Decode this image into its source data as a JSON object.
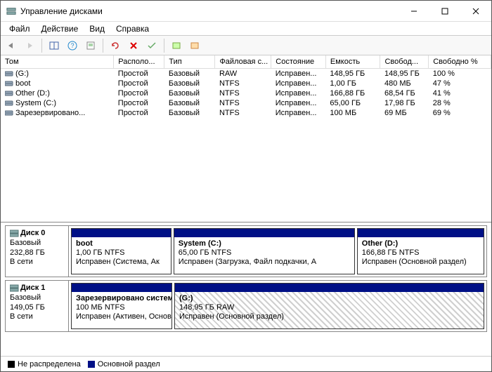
{
  "window": {
    "title": "Управление дисками"
  },
  "menu": {
    "file": "Файл",
    "action": "Действие",
    "view": "Вид",
    "help": "Справка"
  },
  "columns": {
    "volume": "Том",
    "layout": "Располо...",
    "type": "Тип",
    "fs": "Файловая с...",
    "status": "Состояние",
    "capacity": "Емкость",
    "free": "Свобод...",
    "free_pct": "Свободно %"
  },
  "col_widths": {
    "volume": 145,
    "layout": 65,
    "type": 65,
    "fs": 72,
    "status": 70,
    "capacity": 70,
    "free": 62,
    "free_pct": 80
  },
  "volumes": [
    {
      "name": "(G:)",
      "layout": "Простой",
      "type": "Базовый",
      "fs": "RAW",
      "status": "Исправен...",
      "capacity": "148,95 ГБ",
      "free": "148,95 ГБ",
      "free_pct": "100 %"
    },
    {
      "name": "boot",
      "layout": "Простой",
      "type": "Базовый",
      "fs": "NTFS",
      "status": "Исправен...",
      "capacity": "1,00 ГБ",
      "free": "480 МБ",
      "free_pct": "47 %"
    },
    {
      "name": "Other (D:)",
      "layout": "Простой",
      "type": "Базовый",
      "fs": "NTFS",
      "status": "Исправен...",
      "capacity": "166,88 ГБ",
      "free": "68,54 ГБ",
      "free_pct": "41 %"
    },
    {
      "name": "System (C:)",
      "layout": "Простой",
      "type": "Базовый",
      "fs": "NTFS",
      "status": "Исправен...",
      "capacity": "65,00 ГБ",
      "free": "17,98 ГБ",
      "free_pct": "28 %"
    },
    {
      "name": "Зарезервировано...",
      "layout": "Простой",
      "type": "Базовый",
      "fs": "NTFS",
      "status": "Исправен...",
      "capacity": "100 МБ",
      "free": "69 МБ",
      "free_pct": "69 %"
    }
  ],
  "disks": [
    {
      "title": "Диск 0",
      "type": "Базовый",
      "size": "232,88 ГБ",
      "state": "В сети",
      "partitions": [
        {
          "name": "boot",
          "sub": "1,00 ГБ NTFS",
          "status": "Исправен (Система, Ак",
          "flex": 1.1,
          "hatched": false
        },
        {
          "name": "System  (C:)",
          "sub": "65,00 ГБ NTFS",
          "status": "Исправен (Загрузка, Файл подкачки, А",
          "flex": 2.0,
          "hatched": false
        },
        {
          "name": "Other  (D:)",
          "sub": "166,88 ГБ NTFS",
          "status": "Исправен (Основной раздел)",
          "flex": 1.4,
          "hatched": false
        }
      ]
    },
    {
      "title": "Диск 1",
      "type": "Базовый",
      "size": "149,05 ГБ",
      "state": "В сети",
      "partitions": [
        {
          "name": "Зарезервировано системс",
          "sub": "100 МБ NTFS",
          "status": "Исправен (Активен, Основн",
          "flex": 1.1,
          "hatched": false
        },
        {
          "name": "(G:)",
          "sub": "148,95 ГБ RAW",
          "status": "Исправен (Основной раздел)",
          "flex": 3.4,
          "hatched": true
        }
      ]
    }
  ],
  "legend": {
    "unallocated": "Не распределена",
    "primary": "Основной раздел"
  }
}
